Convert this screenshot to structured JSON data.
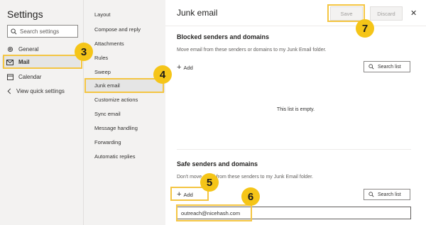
{
  "settings": {
    "title": "Settings",
    "search_placeholder": "Search settings",
    "nav": [
      {
        "label": "General",
        "icon": "gear-icon"
      },
      {
        "label": "Mail",
        "icon": "mail-icon"
      },
      {
        "label": "Calendar",
        "icon": "calendar-icon"
      },
      {
        "label": "View quick settings",
        "icon": "chevron-left-icon"
      }
    ],
    "selected_nav": "Mail"
  },
  "mail_menu": {
    "items": [
      "Layout",
      "Compose and reply",
      "Attachments",
      "Rules",
      "Sweep",
      "Junk email",
      "Customize actions",
      "Sync email",
      "Message handling",
      "Forwarding",
      "Automatic replies"
    ],
    "selected": "Junk email"
  },
  "junk_email": {
    "title": "Junk email",
    "save_label": "Save",
    "discard_label": "Discard",
    "blocked": {
      "title": "Blocked senders and domains",
      "description": "Move email from these senders or domains to my Junk Email folder.",
      "add_label": "Add",
      "search_label": "Search list",
      "empty_message": "This list is empty."
    },
    "safe": {
      "title": "Safe senders and domains",
      "description": "Don't move email from these senders to my Junk Email folder.",
      "add_label": "Add",
      "search_label": "Search list",
      "input_value": "outreach@nicehash.com"
    }
  },
  "step_markers": [
    "3",
    "4",
    "5",
    "6",
    "7"
  ],
  "colors": {
    "highlight": "#f4c542",
    "marker": "#f5c518",
    "selected_bg": "#e5e5e5",
    "pane_bg": "#f3f2f1"
  }
}
